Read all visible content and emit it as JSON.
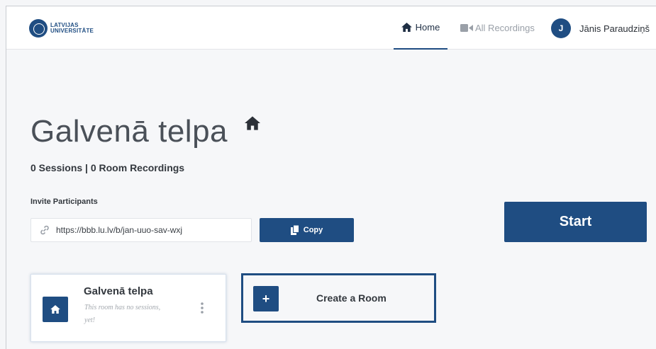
{
  "colors": {
    "accent": "#1f4d82",
    "background": "#f6f7f9"
  },
  "logo": {
    "line1": "LATVIJAS",
    "line2": "UNIVERSITĀTE",
    "icon": "university-seal"
  },
  "nav": {
    "home_label": "Home",
    "home_icon": "home-icon",
    "recordings_label": "All Recordings",
    "recordings_icon": "video-camera-icon",
    "user_initial": "J",
    "user_name": "Jānis Paraudziņš"
  },
  "room": {
    "title": "Galvenā telpa",
    "stats": "0 Sessions | 0 Room Recordings",
    "invite_label": "Invite Participants",
    "invite_url": "https://bbb.lu.lv/b/jan-uuo-sav-wxj",
    "copy_label": "Copy",
    "start_label": "Start"
  },
  "room_card": {
    "name": "Galvenā telpa",
    "description": "This room has no sessions, yet!"
  },
  "create_room": {
    "plus": "+",
    "label": "Create a Room"
  }
}
